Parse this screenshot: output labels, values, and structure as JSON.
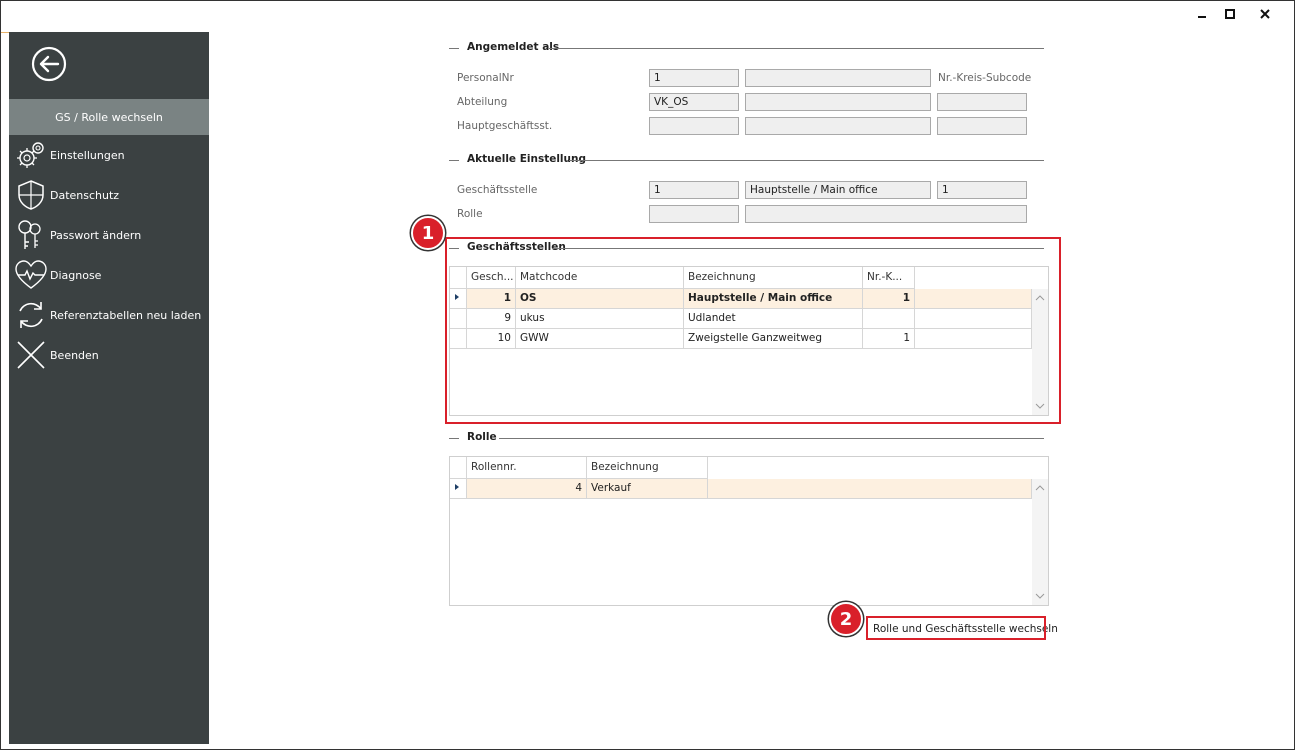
{
  "sidebar": {
    "active": "GS / Rolle wechseln",
    "items": [
      {
        "label": "Einstellungen",
        "icon": "gears-icon"
      },
      {
        "label": "Datenschutz",
        "icon": "shield-icon"
      },
      {
        "label": "Passwort ändern",
        "icon": "keys-icon"
      },
      {
        "label": "Diagnose",
        "icon": "heart-pulse-icon"
      },
      {
        "label": "Referenztabellen neu laden",
        "icon": "refresh-icon"
      },
      {
        "label": "Beenden",
        "icon": "close-x-icon"
      }
    ]
  },
  "angemeldet": {
    "title": "Angemeldet als",
    "personalnr_label": "PersonalNr",
    "personalnr_value": "1",
    "abteilung_label": "Abteilung",
    "abteilung_value": "VK_OS",
    "hauptgs_label": "Hauptgeschäftsst.",
    "kreis_label": "Nr.-Kreis-Subcode"
  },
  "aktuell": {
    "title": "Aktuelle Einstellung",
    "gs_label": "Geschäftsstelle",
    "gs_nr": "1",
    "gs_name": "Hauptstelle / Main office",
    "gs_code": "1",
    "rolle_label": "Rolle"
  },
  "geschaeftsstellen": {
    "title": "Geschäftsstellen",
    "headers": [
      "Gesch...",
      "Matchcode",
      "Bezeichnung",
      "Nr.-K..."
    ],
    "rows": [
      {
        "nr": "1",
        "matchcode": "OS",
        "bezeichnung": "Hauptstelle / Main office",
        "kreis": "1"
      },
      {
        "nr": "9",
        "matchcode": "ukus",
        "bezeichnung": "Udlandet",
        "kreis": ""
      },
      {
        "nr": "10",
        "matchcode": "GWW",
        "bezeichnung": "Zweigstelle Ganzweitweg",
        "kreis": "1"
      }
    ]
  },
  "rolle": {
    "title": "Rolle",
    "headers": [
      "Rollennr.",
      "Bezeichnung"
    ],
    "rows": [
      {
        "nr": "4",
        "bezeichnung": "Verkauf"
      }
    ]
  },
  "action_button": "Rolle und Geschäftsstelle wechseln",
  "callouts": [
    "1",
    "2"
  ],
  "colors": {
    "sidebar": "#3b4142",
    "active": "#7a8383",
    "callout": "#d9202a",
    "selected_row": "#fdf0e0"
  }
}
